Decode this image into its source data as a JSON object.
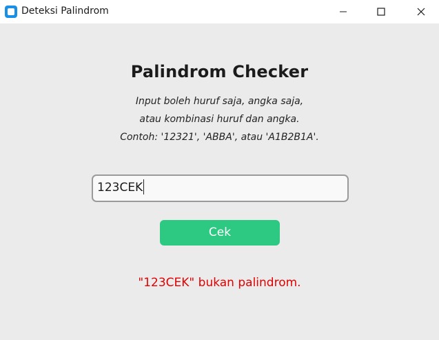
{
  "window": {
    "title": "Deteksi Palindrom"
  },
  "main": {
    "heading": "Palindrom Checker",
    "description": [
      "Input boleh huruf saja, angka saja,",
      "atau kombinasi huruf dan angka.",
      "Contoh: '12321', 'ABBA', atau 'A1B2B1A'."
    ],
    "input_value": "123CEK",
    "button_label": "Cek",
    "result_text": "\"123CEK\" bukan palindrom."
  },
  "colors": {
    "button": "#2dc983",
    "result": "#e30000",
    "app_icon": "#1a8fe6"
  },
  "icons": {
    "app": "app-icon",
    "minimize": "minimize-icon",
    "maximize": "maximize-icon",
    "close": "close-icon"
  }
}
